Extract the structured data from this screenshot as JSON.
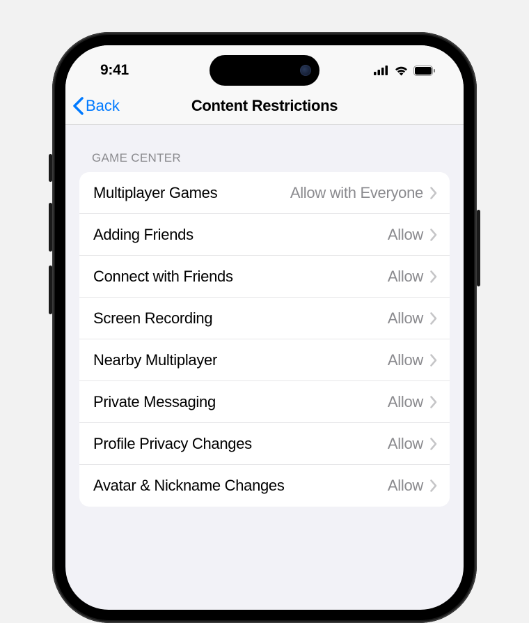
{
  "statusBar": {
    "time": "9:41"
  },
  "navBar": {
    "backLabel": "Back",
    "title": "Content Restrictions"
  },
  "section": {
    "header": "GAME CENTER",
    "rows": [
      {
        "label": "Multiplayer Games",
        "value": "Allow with Everyone"
      },
      {
        "label": "Adding Friends",
        "value": "Allow"
      },
      {
        "label": "Connect with Friends",
        "value": "Allow"
      },
      {
        "label": "Screen Recording",
        "value": "Allow"
      },
      {
        "label": "Nearby Multiplayer",
        "value": "Allow"
      },
      {
        "label": "Private Messaging",
        "value": "Allow"
      },
      {
        "label": "Profile Privacy Changes",
        "value": "Allow"
      },
      {
        "label": "Avatar & Nickname Changes",
        "value": "Allow"
      }
    ]
  }
}
